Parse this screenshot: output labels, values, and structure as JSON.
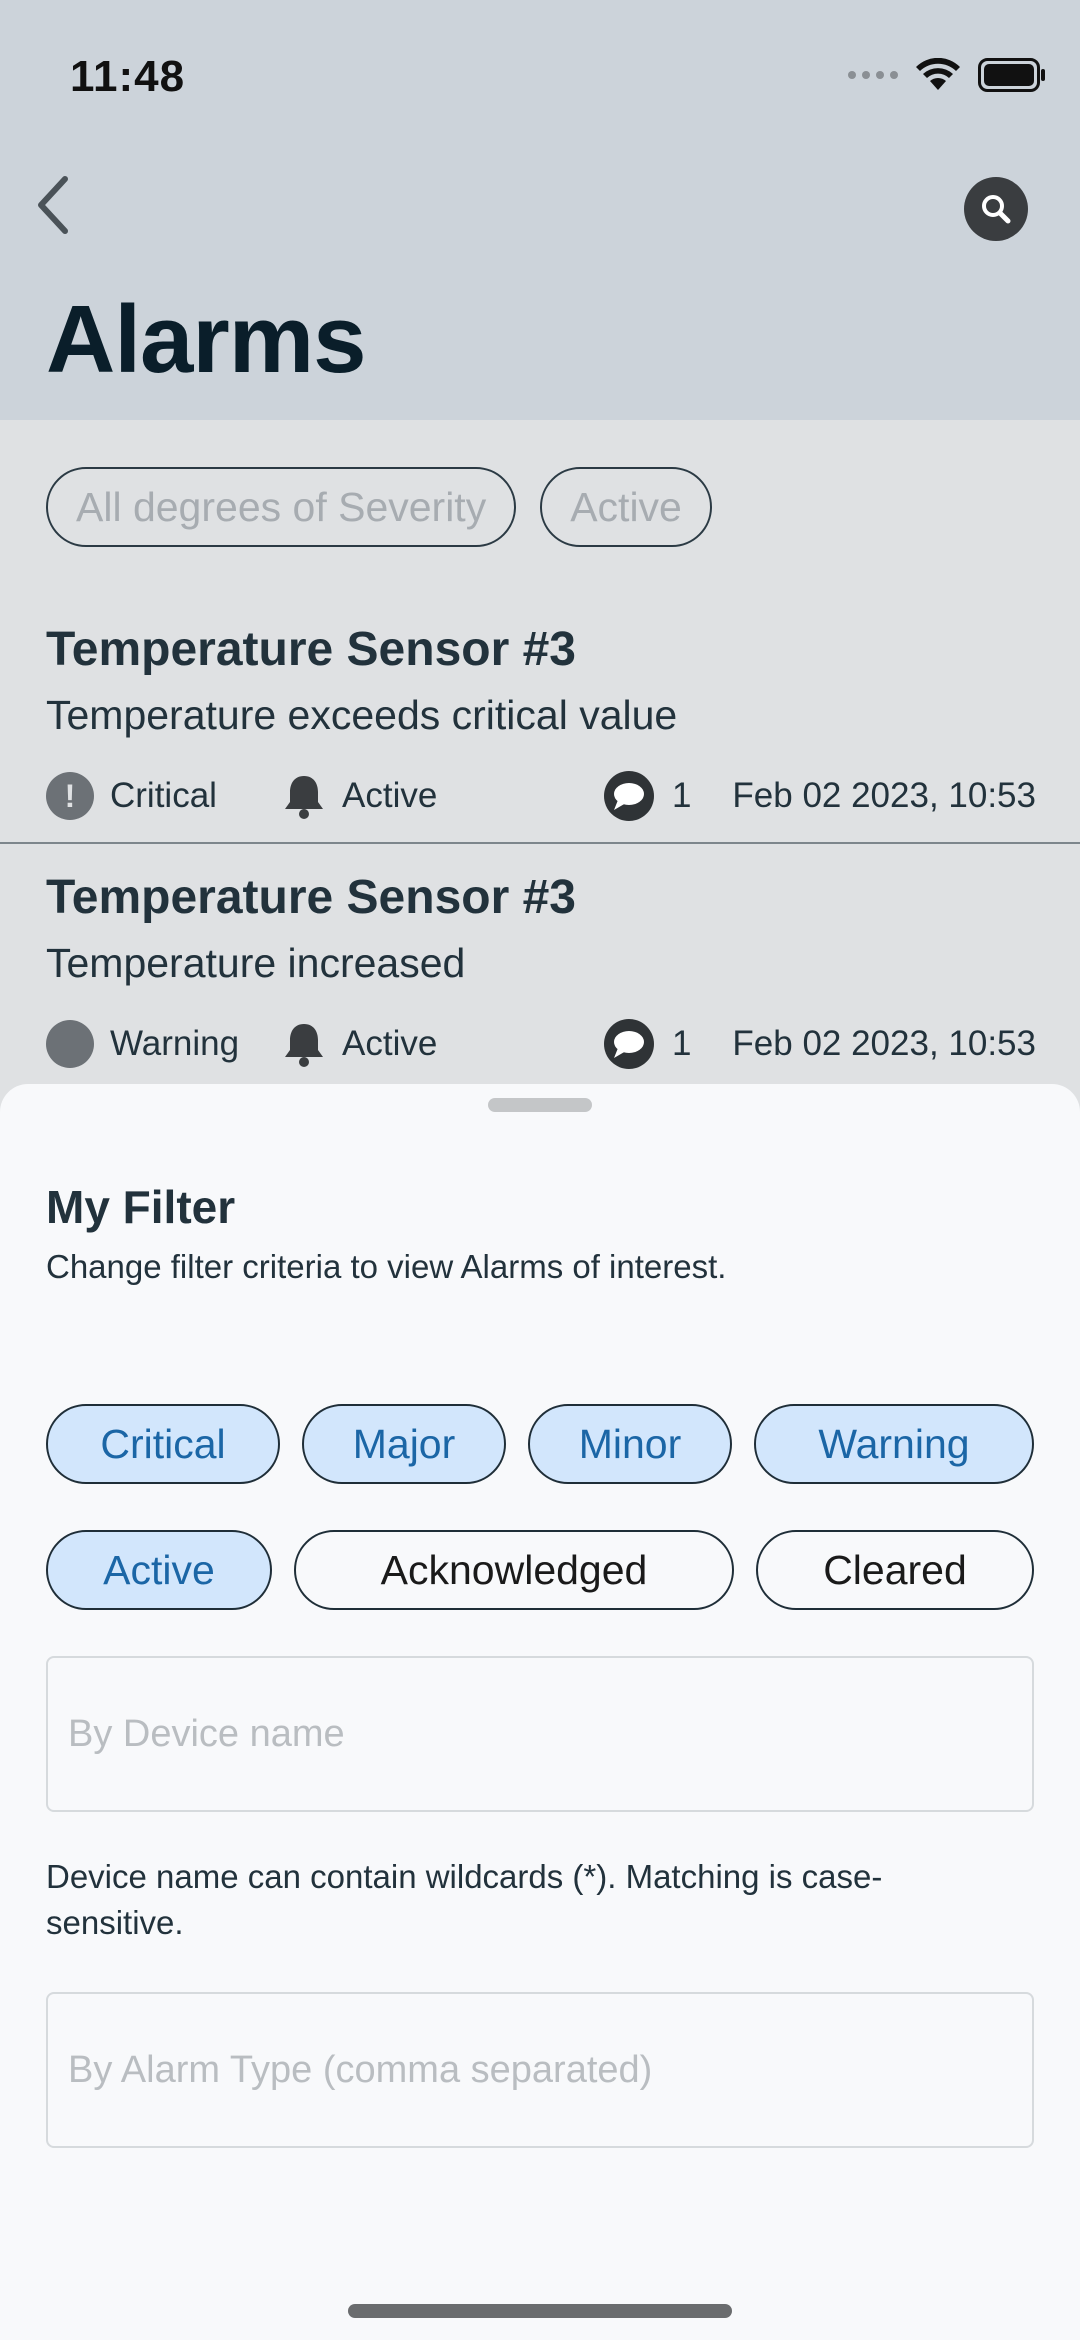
{
  "status_bar": {
    "time": "11:48"
  },
  "header": {
    "title": "Alarms"
  },
  "filter_chips": [
    "All degrees of Severity",
    "Active"
  ],
  "alarms": [
    {
      "device": "Temperature Sensor #3",
      "text": "Temperature exceeds critical value",
      "severity": "Critical",
      "status": "Active",
      "comments": "1",
      "time": "Feb 02 2023, 10:53"
    },
    {
      "device": "Temperature Sensor #3",
      "text": "Temperature increased",
      "severity": "Warning",
      "status": "Active",
      "comments": "1",
      "time": "Feb 02 2023, 10:53"
    }
  ],
  "sheet": {
    "title": "My Filter",
    "subtitle": "Change filter criteria to view Alarms of interest.",
    "severity_chips": [
      {
        "label": "Critical",
        "selected": true
      },
      {
        "label": "Major",
        "selected": true
      },
      {
        "label": "Minor",
        "selected": true
      },
      {
        "label": "Warning",
        "selected": true
      }
    ],
    "status_chips": [
      {
        "label": "Active",
        "selected": true
      },
      {
        "label": "Acknowledged",
        "selected": false
      },
      {
        "label": "Cleared",
        "selected": false
      }
    ],
    "device_field": {
      "value": "",
      "placeholder": "By Device name"
    },
    "device_hint": "Device name can contain wildcards (*). Matching is case-sensitive.",
    "type_field": {
      "value": "",
      "placeholder": "By Alarm Type (comma separated)"
    }
  },
  "colors": {
    "header_bg": "#ccd3da",
    "selected_chip_bg": "#d2e6fc",
    "selected_chip_text": "#1b66a6"
  }
}
